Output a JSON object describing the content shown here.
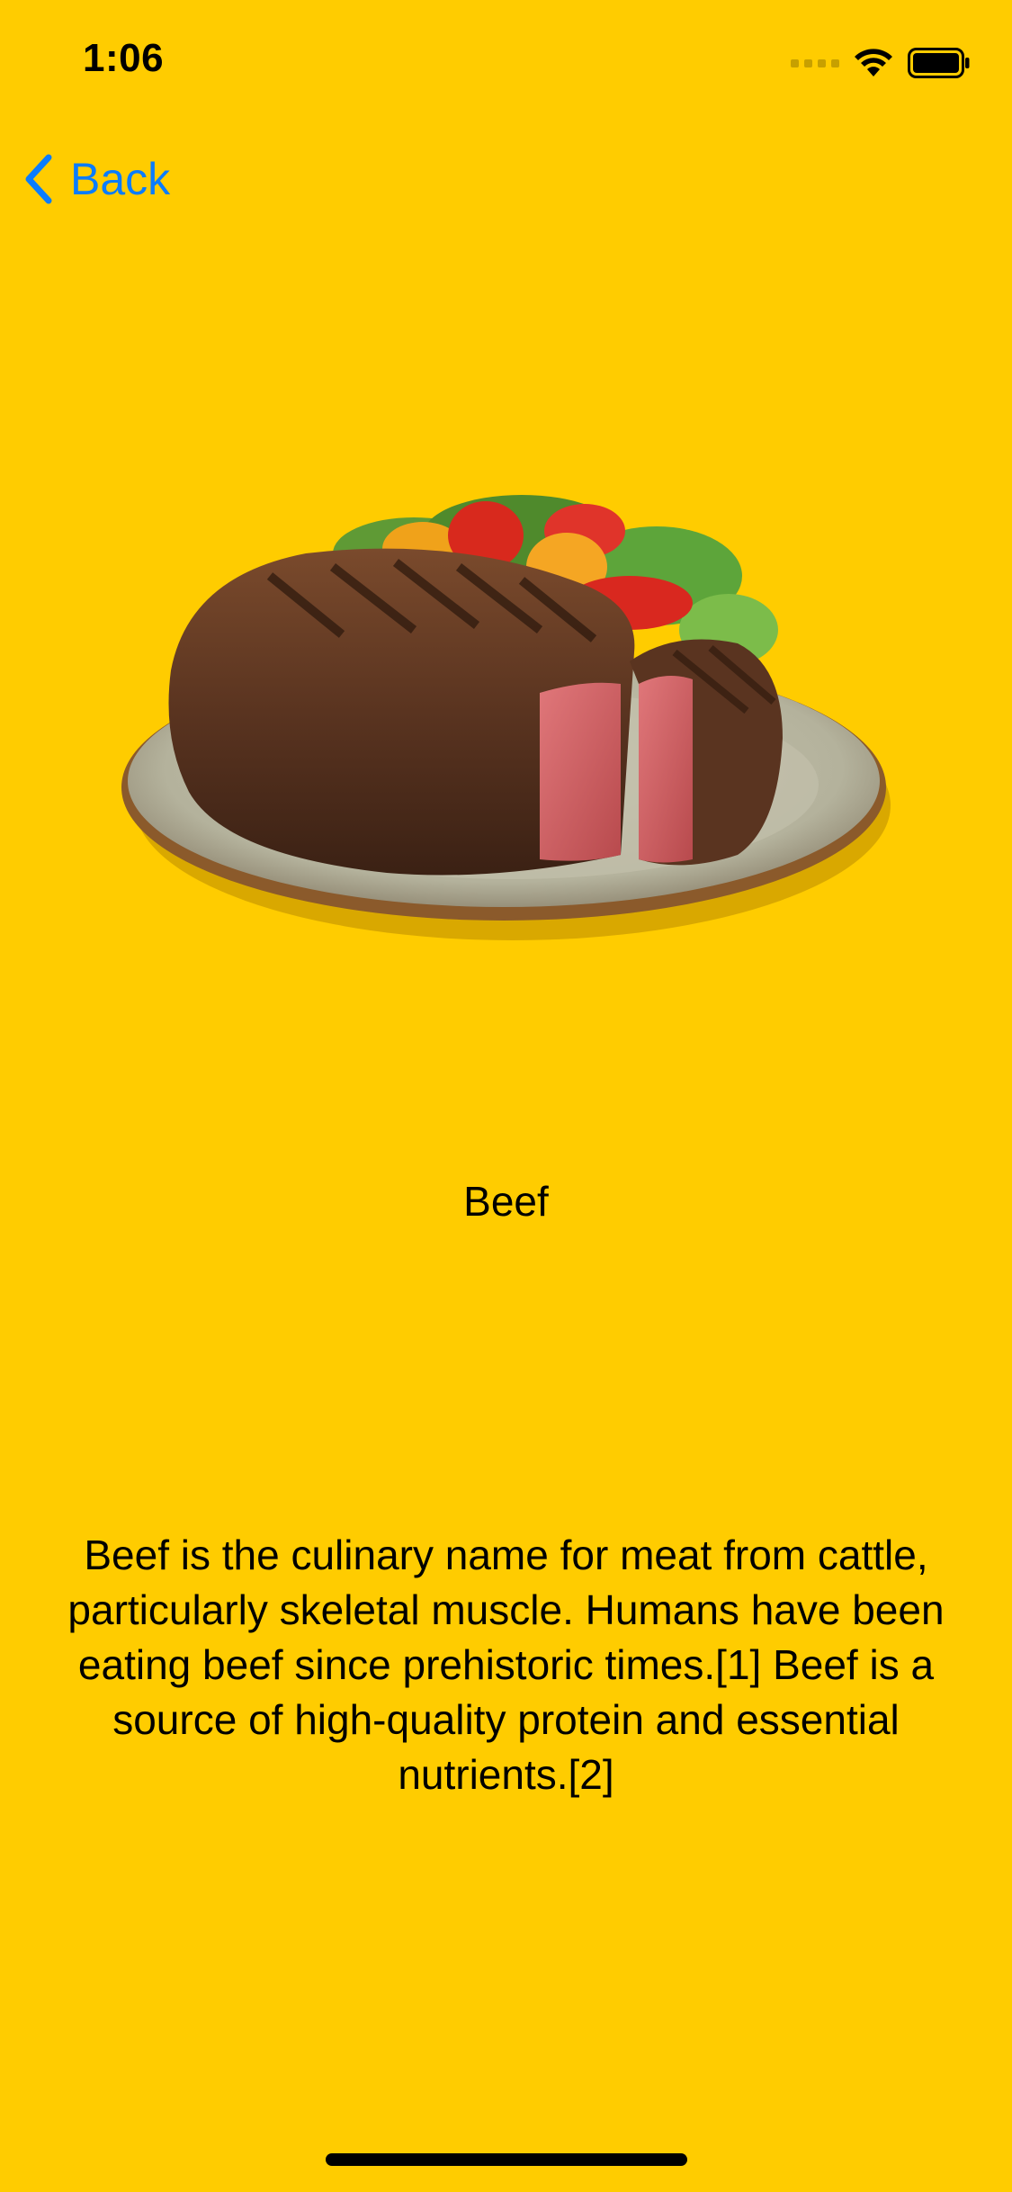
{
  "status_bar": {
    "time": "1:06"
  },
  "nav": {
    "back_label": "Back"
  },
  "item": {
    "title": "Beef",
    "description": "Beef is the culinary name for meat from cattle, particularly skeletal muscle. Humans have been eating beef since prehistoric times.[1] Beef is a source of high-quality protein and essential nutrients.[2]"
  },
  "colors": {
    "background": "#FFCC00",
    "accent": "#0A7CFF",
    "text": "#000000"
  },
  "icons": {
    "back": "chevron-left-icon",
    "wifi": "wifi-icon",
    "battery": "battery-icon",
    "signal": "cellular-signal-icon"
  }
}
